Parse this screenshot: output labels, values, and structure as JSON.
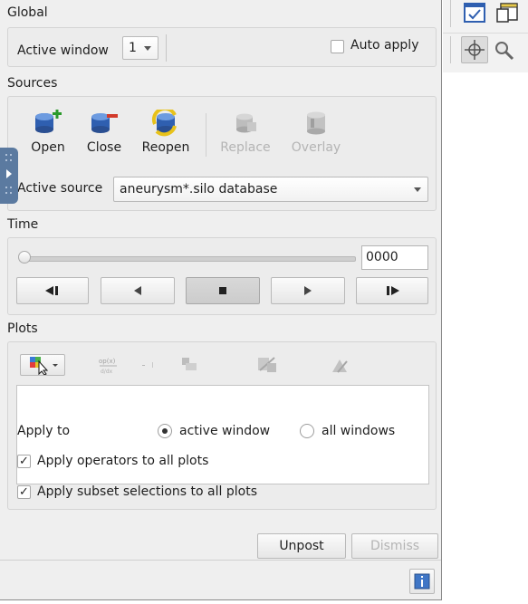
{
  "global": {
    "title": "Global",
    "active_window_label": "Active window",
    "active_window_value": "1",
    "auto_apply_label": "Auto apply",
    "auto_apply_checked": false
  },
  "sources": {
    "title": "Sources",
    "buttons": [
      {
        "label": "Open",
        "icon": "open-database-icon",
        "enabled": true
      },
      {
        "label": "Close",
        "icon": "close-database-icon",
        "enabled": true
      },
      {
        "label": "Reopen",
        "icon": "reopen-database-icon",
        "enabled": true
      },
      {
        "label": "Replace",
        "icon": "replace-database-icon",
        "enabled": false
      },
      {
        "label": "Overlay",
        "icon": "overlay-database-icon",
        "enabled": false
      }
    ],
    "active_source_label": "Active source",
    "active_source_value": "aneurysm*.silo database"
  },
  "time": {
    "title": "Time",
    "slider_value_fraction": 0,
    "frame_value": "0000",
    "controls": [
      "previous-frame",
      "reverse-play",
      "stop",
      "play",
      "next-frame"
    ],
    "active_control": "stop"
  },
  "plots": {
    "title": "Plots",
    "apply_to_label": "Apply to",
    "active_window_option": "active window",
    "all_windows_option": "all windows",
    "apply_to_selected": "active window",
    "apply_operators_label": "Apply operators to all plots",
    "apply_operators_checked": true,
    "apply_subset_label": "Apply subset selections to all plots",
    "apply_subset_checked": true
  },
  "footer": {
    "unpost_label": "Unpost",
    "dismiss_label": "Dismiss"
  },
  "colors": {
    "panel_bg": "#efefef",
    "handle_blue": "#5b7aa0",
    "disabled_text": "#b4b4b4"
  }
}
